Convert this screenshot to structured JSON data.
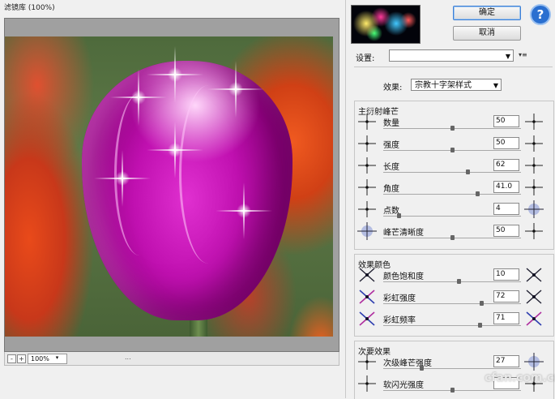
{
  "preview_window": {
    "title": "滤镜库 (100%)",
    "zoom_value": "100%",
    "zoom_minus": "-",
    "zoom_plus": "+",
    "bottom_indicator": "..."
  },
  "panel": {
    "ok_label": "确定",
    "cancel_label": "取消",
    "help_label": "?",
    "settings_label": "设置:",
    "settings_value": "",
    "effect_label": "效果:",
    "effect_value": "宗教十字架样式",
    "sections": [
      {
        "title": "主衍射峰芒",
        "rows": [
          {
            "label": "数量",
            "value": "50",
            "slider": 0.5
          },
          {
            "label": "强度",
            "value": "50",
            "slider": 0.5
          },
          {
            "label": "长度",
            "value": "62",
            "slider": 0.62
          },
          {
            "label": "角度",
            "value": "41.0",
            "slider": 0.69
          },
          {
            "label": "点数",
            "value": "4",
            "slider": 0.1
          },
          {
            "label": "峰芒清晰度",
            "value": "50",
            "slider": 0.5
          }
        ]
      },
      {
        "title": "效果颜色",
        "rows": [
          {
            "label": "颜色饱和度",
            "value": "10",
            "slider": 0.55
          },
          {
            "label": "彩虹强度",
            "value": "72",
            "slider": 0.72
          },
          {
            "label": "彩虹频率",
            "value": "71",
            "slider": 0.71
          }
        ]
      },
      {
        "title": "次要效果",
        "rows": [
          {
            "label": "次级峰芒强度",
            "value": "27",
            "slider": 0.27
          },
          {
            "label": "软闪光强度",
            "value": "",
            "slider": 0.5
          }
        ]
      }
    ]
  },
  "watermark_text": "cfan.com.cn"
}
